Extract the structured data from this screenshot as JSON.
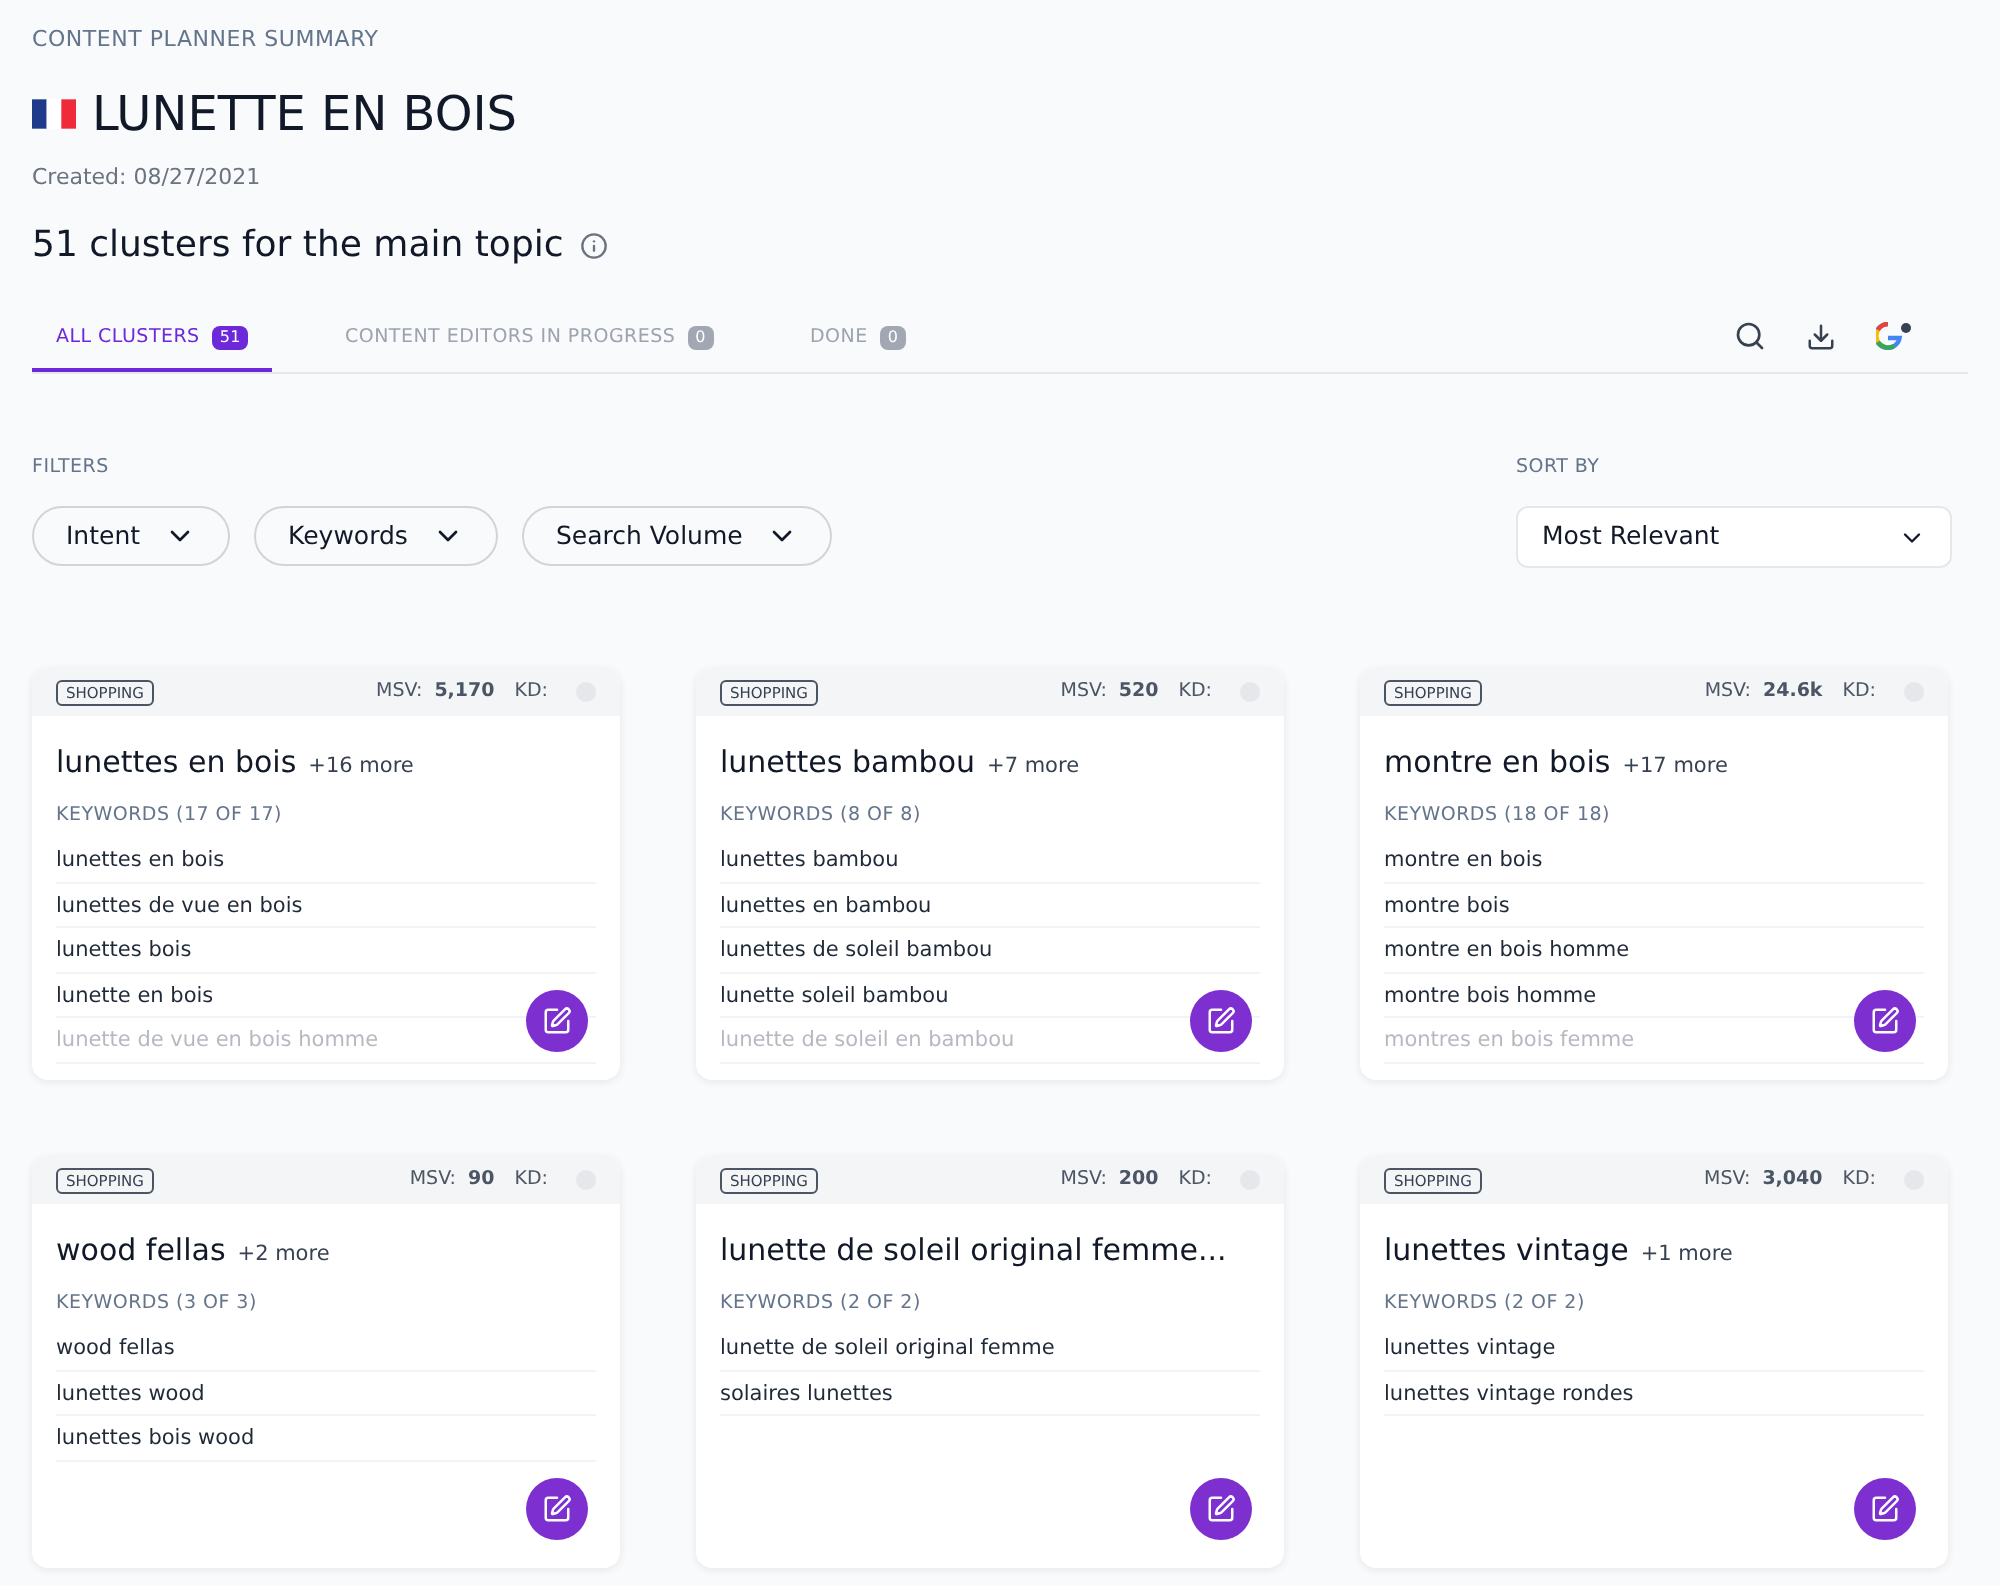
{
  "header": {
    "eyebrow": "CONTENT PLANNER SUMMARY",
    "title": "LUNETTE EN BOIS",
    "created": "Created: 08/27/2021",
    "subtitle": "51 clusters for the main topic"
  },
  "tabs": [
    {
      "label": "ALL CLUSTERS",
      "count": "51",
      "selected": true
    },
    {
      "label": "CONTENT EDITORS IN PROGRESS",
      "count": "0",
      "selected": false
    },
    {
      "label": "DONE",
      "count": "0",
      "selected": false
    }
  ],
  "filters": {
    "label": "FILTERS",
    "items": [
      "Intent",
      "Keywords",
      "Search Volume"
    ]
  },
  "sort": {
    "label": "SORT BY",
    "value": "Most Relevant"
  },
  "clusters": [
    {
      "tag": "SHOPPING",
      "msv_label": "MSV:",
      "msv": "5,170",
      "kd_label": "KD:",
      "title": "lunettes en bois",
      "more": "+16 more",
      "keywords_label": "KEYWORDS (17 OF 17)",
      "keywords": [
        {
          "text": "lunettes en bois",
          "faded": false
        },
        {
          "text": "lunettes de vue en bois",
          "faded": false
        },
        {
          "text": "lunettes bois",
          "faded": false
        },
        {
          "text": "lunette en bois",
          "faded": false
        },
        {
          "text": "lunette de vue en bois homme",
          "faded": true
        }
      ]
    },
    {
      "tag": "SHOPPING",
      "msv_label": "MSV:",
      "msv": "520",
      "kd_label": "KD:",
      "title": "lunettes bambou",
      "more": "+7 more",
      "keywords_label": "KEYWORDS (8 OF 8)",
      "keywords": [
        {
          "text": "lunettes bambou",
          "faded": false
        },
        {
          "text": "lunettes en bambou",
          "faded": false
        },
        {
          "text": "lunettes de soleil bambou",
          "faded": false
        },
        {
          "text": "lunette soleil bambou",
          "faded": false
        },
        {
          "text": "lunette de soleil en bambou",
          "faded": true
        }
      ]
    },
    {
      "tag": "SHOPPING",
      "msv_label": "MSV:",
      "msv": "24.6k",
      "kd_label": "KD:",
      "title": "montre en bois",
      "more": "+17 more",
      "keywords_label": "KEYWORDS (18 OF 18)",
      "keywords": [
        {
          "text": "montre en bois",
          "faded": false
        },
        {
          "text": "montre bois",
          "faded": false
        },
        {
          "text": "montre en bois homme",
          "faded": false
        },
        {
          "text": "montre bois homme",
          "faded": false
        },
        {
          "text": "montres en bois femme",
          "faded": true
        }
      ]
    },
    {
      "tag": "SHOPPING",
      "msv_label": "MSV:",
      "msv": "90",
      "kd_label": "KD:",
      "title": "wood fellas",
      "more": "+2 more",
      "keywords_label": "KEYWORDS (3 OF 3)",
      "keywords": [
        {
          "text": "wood fellas",
          "faded": false
        },
        {
          "text": "lunettes wood",
          "faded": false
        },
        {
          "text": "lunettes bois wood",
          "faded": false
        }
      ]
    },
    {
      "tag": "SHOPPING",
      "msv_label": "MSV:",
      "msv": "200",
      "kd_label": "KD:",
      "title": "lunette de soleil original femme...",
      "keywords_label": "KEYWORDS (2 OF 2)",
      "keywords": [
        {
          "text": "lunette de soleil original femme",
          "faded": false
        },
        {
          "text": "solaires lunettes",
          "faded": false
        }
      ]
    },
    {
      "tag": "SHOPPING",
      "msv_label": "MSV:",
      "msv": "3,040",
      "kd_label": "KD:",
      "title": "lunettes vintage",
      "more": "+1 more",
      "keywords_label": "KEYWORDS (2 OF 2)",
      "keywords": [
        {
          "text": "lunettes vintage",
          "faded": false
        },
        {
          "text": "lunettes vintage rondes",
          "faded": false
        }
      ]
    }
  ]
}
